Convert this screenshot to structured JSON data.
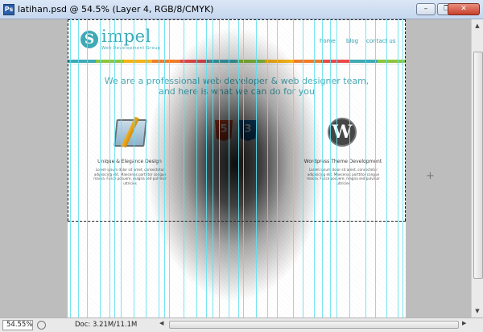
{
  "window": {
    "title": "latihan.psd @ 54.5% (Layer 4, RGB/8/CMYK)",
    "app_icon_label": "Ps",
    "controls": {
      "minimize": "–",
      "restore": "❐",
      "close": "✕"
    }
  },
  "site": {
    "logo_mark": "S",
    "logo_text": "impel",
    "tagline": "Web Development Group",
    "nav": [
      "home",
      "blog",
      "contact us"
    ],
    "headline_line1": "We are a professional web developer & web designer team,",
    "headline_line2": "and here is what we can do for you",
    "html_badge": "5",
    "css_badge": "3",
    "columns": [
      {
        "title": "Unique & Elegance Design",
        "body": "Lorem ipsum dolor sit amet, consectetur adipisicing elit. Maecenas porttitor congue massa. Fusce posuere, magna sed pulvinar ultricies"
      },
      {
        "title": "Wordpress Theme Development",
        "body": "Lorem ipsum dolor sit amet, consectetur adipisicing elit. Maecenas porttitor congue massa. Fusce posuere, magna sed pulvinar ultricies"
      }
    ],
    "wp_glyph": "W",
    "rainbow_colors": [
      "#3fa9b5",
      "#8cc63f",
      "#f6b319",
      "#ef7d2b",
      "#e94a4a",
      "#3fa9b5",
      "#8cc63f",
      "#f6b319",
      "#ef7d2b",
      "#e94a4a",
      "#3fa9b5",
      "#8cc63f"
    ]
  },
  "status": {
    "zoom": "54.55%",
    "doc_info": "Doc: 3.21M/11.1M"
  },
  "icons": {
    "crosshair": "+",
    "arrow_up": "▲",
    "arrow_down": "▼",
    "arrow_left": "◀",
    "arrow_right": "▶"
  }
}
